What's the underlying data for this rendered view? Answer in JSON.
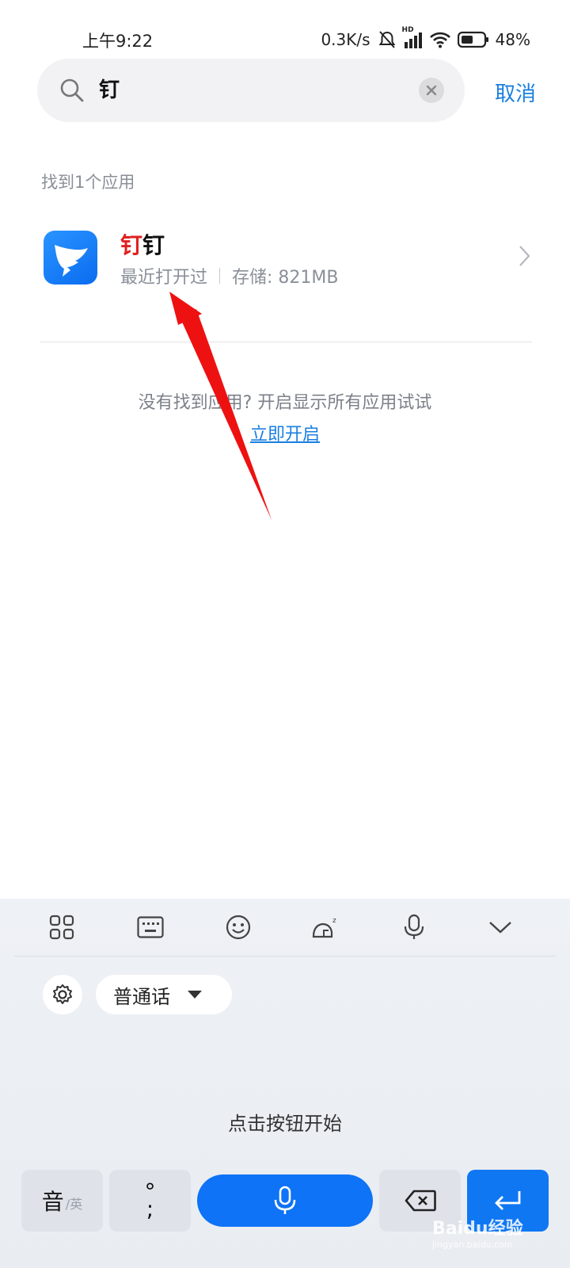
{
  "status_bar": {
    "time": "上午9:22",
    "net_speed": "0.3K/s",
    "network_type": "HD",
    "battery": "48%"
  },
  "search": {
    "query": "钉",
    "cancel_label": "取消"
  },
  "results": {
    "count_label": "找到1个应用",
    "apps": [
      {
        "name_highlight": "钉",
        "name_rest": "钉",
        "recent_label": "最近打开过",
        "storage_label": "存储: 821MB"
      }
    ]
  },
  "not_found": {
    "hint": "没有找到应用? 开启显示所有应用试试",
    "link_label": "立即开启"
  },
  "keyboard": {
    "tools": [
      "grid-icon",
      "keyboard-icon",
      "emoji-icon",
      "sleep-cat-icon",
      "microphone-icon",
      "chevron-down-icon"
    ],
    "language_label": "普通话",
    "tap_hint": "点击按钮开始",
    "pinyin_key": "音",
    "pinyin_key_sub": "/英",
    "punct_key_top": "°",
    "punct_key_bottom": ";"
  },
  "watermark": {
    "brand": "Baidu经验",
    "url": "jingyan.baidu.com"
  },
  "colors": {
    "accent": "#1a7fe0",
    "highlight": "#e02020",
    "app_icon": "#1677ff",
    "annotation_arrow": "#ee1111"
  }
}
